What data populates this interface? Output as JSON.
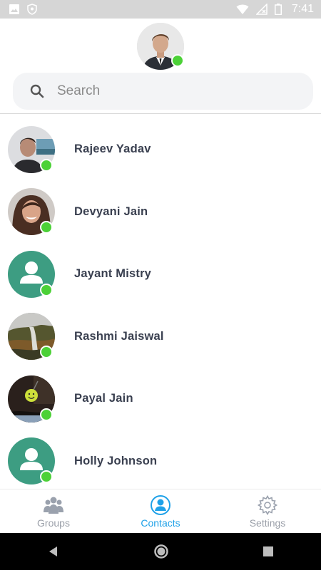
{
  "status_bar": {
    "time": "7:41",
    "icons": [
      "image-icon",
      "shield-icon",
      "wifi-icon",
      "signal-icon",
      "battery-icon"
    ]
  },
  "profile": {
    "status": "online"
  },
  "search": {
    "placeholder": "Search",
    "value": ""
  },
  "contacts": [
    {
      "name": "Rajeev Yadav",
      "avatar": "photo",
      "status": "online"
    },
    {
      "name": "Devyani Jain",
      "avatar": "photo",
      "status": "online"
    },
    {
      "name": "Jayant Mistry",
      "avatar": "default-person-icon",
      "status": "online"
    },
    {
      "name": "Rashmi Jaiswal",
      "avatar": "photo",
      "status": "online"
    },
    {
      "name": "Payal Jain",
      "avatar": "photo",
      "status": "online"
    },
    {
      "name": "Holly Johnson",
      "avatar": "default-person-icon",
      "status": "online"
    }
  ],
  "bottom_nav": {
    "items": [
      {
        "label": "Groups",
        "icon": "groups-icon",
        "active": false
      },
      {
        "label": "Contacts",
        "icon": "contact-icon",
        "active": true
      },
      {
        "label": "Settings",
        "icon": "gear-icon",
        "active": false
      }
    ]
  },
  "colors": {
    "online": "#4cd137",
    "accent": "#1ea1e8",
    "default_avatar": "#3d9d82",
    "inactive_nav": "#9a9fa8"
  }
}
